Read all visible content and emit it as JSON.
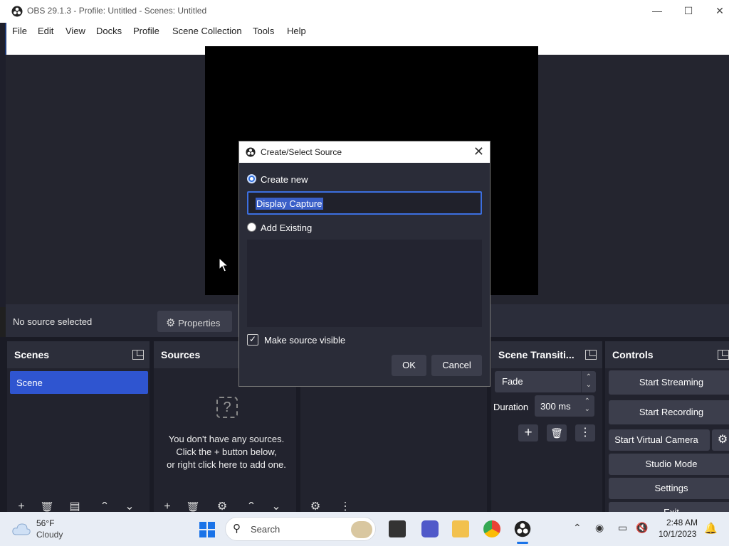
{
  "titlebar": {
    "title": "OBS 29.1.3 - Profile: Untitled - Scenes: Untitled",
    "minimize": "—",
    "maximize": "☐",
    "close": "✕"
  },
  "menu": [
    "File",
    "Edit",
    "View",
    "Docks",
    "Profile",
    "Scene Collection",
    "Tools",
    "Help"
  ],
  "sourcebar": {
    "status": "No source selected",
    "properties_label": "Properties"
  },
  "scenes": {
    "title": "Scenes",
    "items": [
      "Scene"
    ]
  },
  "sources": {
    "title": "Sources",
    "empty_line1": "You don't have any sources.",
    "empty_line2": "Click the + button below,",
    "empty_line3": "or right click here to add one."
  },
  "transitions": {
    "title": "Scene Transiti...",
    "selected": "Fade",
    "duration_label": "Duration",
    "duration_value": "300 ms"
  },
  "controls": {
    "title": "Controls",
    "start_streaming": "Start Streaming",
    "start_recording": "Start Recording",
    "start_virtual_camera": "Start Virtual Camera",
    "studio_mode": "Studio Mode",
    "settings": "Settings",
    "exit": "Exit"
  },
  "dialog": {
    "title": "Create/Select Source",
    "create_new_label": "Create new",
    "name_value": "Display Capture",
    "add_existing_label": "Add Existing",
    "make_visible_label": "Make source visible",
    "ok_label": "OK",
    "cancel_label": "Cancel",
    "create_new_checked": true,
    "make_visible_checked": true
  },
  "taskbar": {
    "weather_temp": "56°F",
    "weather_desc": "Cloudy",
    "search_placeholder": "Search",
    "time": "2:48 AM",
    "date": "10/1/2023"
  },
  "colors": {
    "accent": "#2f55d0",
    "dialog_bg": "#2a2c38",
    "dock_bg": "#22232e"
  }
}
